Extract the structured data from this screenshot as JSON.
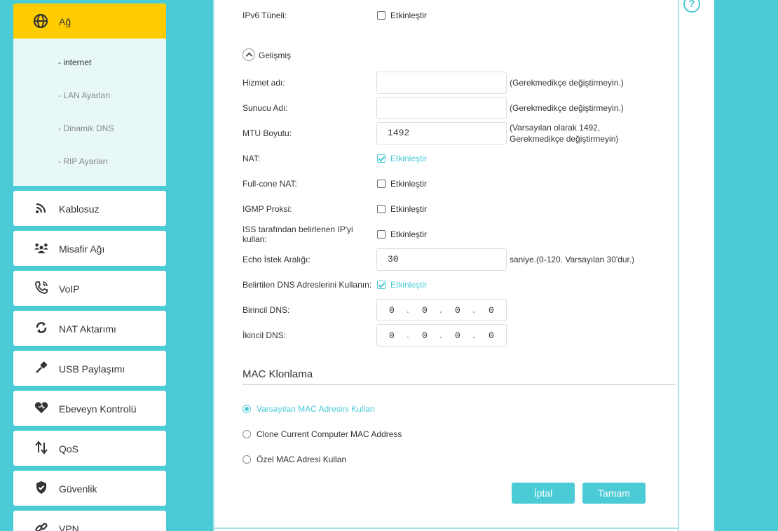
{
  "sidebar": {
    "active": {
      "label": "Ağ",
      "icon": "globe-icon"
    },
    "submenu": [
      "- internet",
      "- LAN Ayarları",
      "- Dinamik DNS",
      "- RIP Ayarları"
    ],
    "items": [
      {
        "label": "Kablosuz",
        "icon": "wireless-icon"
      },
      {
        "label": "Misafir Ağı",
        "icon": "guest-network-icon"
      },
      {
        "label": "VoIP",
        "icon": "phone-icon"
      },
      {
        "label": "NAT Aktarımı",
        "icon": "nat-forwarding-icon"
      },
      {
        "label": "USB Paylaşımı",
        "icon": "usb-icon"
      },
      {
        "label": "Ebeveyn Kontrolü",
        "icon": "heart-icon"
      },
      {
        "label": "QoS",
        "icon": "qos-arrows-icon"
      },
      {
        "label": "Güvenlik",
        "icon": "shield-icon"
      },
      {
        "label": "VPN",
        "icon": "link-icon"
      }
    ]
  },
  "form": {
    "ipv6_tunnel": {
      "label": "IPv6 Tüneli:",
      "option": "Etkinleştir",
      "checked": false
    },
    "advanced_label": "Gelişmiş",
    "service_name": {
      "label": "Hizmet adı:",
      "value": "",
      "hint": "(Gerekmedikçe değiştirmeyin.)"
    },
    "server_name": {
      "label": "Sunucu Adı:",
      "value": "",
      "hint": "(Gerekmedikçe değiştirmeyin.)"
    },
    "mtu": {
      "label": "MTU Boyutu:",
      "value": "1492",
      "hint_line1": "(Varsayılan olarak 1492,",
      "hint_line2": "Gerekmedikçe değiştirmeyin)"
    },
    "nat": {
      "label": "NAT:",
      "option": "Etkinleştir",
      "checked": true
    },
    "full_cone_nat": {
      "label": "Full-cone NAT:",
      "option": "Etkinleştir",
      "checked": false
    },
    "igmp_proxy": {
      "label": "IGMP Proksi:",
      "option": "Etkinleştir",
      "checked": false
    },
    "isp_ip": {
      "label_line1": "ISS tarafından belirlenen IP'yi",
      "label_line2": "kullan:",
      "option": "Etkinleştir",
      "checked": false
    },
    "echo_interval": {
      "label": "Echo İstek Aralığı:",
      "value": "30",
      "hint": "saniye.(0-120. Varsayılan 30'dur.)"
    },
    "use_dns": {
      "label": "Belirtilen DNS Adreslerini Kullanın:",
      "option": "Etkinleştir",
      "checked": true
    },
    "primary_dns": {
      "label": "Birincil DNS:",
      "octets": [
        "0",
        "0",
        "0",
        "0"
      ]
    },
    "secondary_dns": {
      "label": "İkincil DNS:",
      "octets": [
        "0",
        "0",
        "0",
        "0"
      ]
    }
  },
  "mac_clone": {
    "title": "MAC Klonlama",
    "options": [
      {
        "label": "Varsayılan MAC Adresini Kullan",
        "selected": true
      },
      {
        "label": "Clone Current Computer MAC Address",
        "selected": false
      },
      {
        "label": "Özel MAC Adresi Kullan",
        "selected": false
      }
    ]
  },
  "buttons": {
    "cancel": "İptal",
    "ok": "Tamam"
  },
  "help_icon": "?",
  "colors": {
    "accent": "#4acbd6",
    "active_nav": "#ffcc00",
    "background": "#4acbd6"
  }
}
